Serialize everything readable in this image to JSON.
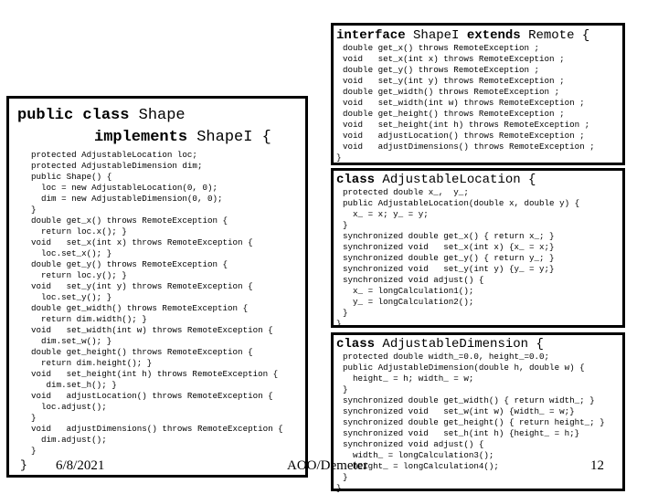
{
  "interface_box": {
    "kw1": "interface",
    "name": "ShapeI",
    "kw2": "extends",
    "parent": "Remote {",
    "lines": [
      "double get_x() throws RemoteException ;",
      "void   set_x(int x) throws RemoteException ;",
      "double get_y() throws RemoteException ;",
      "void   set_y(int y) throws RemoteException ;",
      "double get_width() throws RemoteException ;",
      "void   set_width(int w) throws RemoteException ;",
      "double get_height() throws RemoteException ;",
      "void   set_height(int h) throws RemoteException ;",
      "void   adjustLocation() throws RemoteException ;",
      "void   adjustDimensions() throws RemoteException ;"
    ],
    "close": "}"
  },
  "location_box": {
    "kw": "class",
    "name": "AdjustableLocation {",
    "lines": [
      "protected double x_,  y_;",
      "public AdjustableLocation(double x, double y) {",
      "  x_ = x; y_ = y;",
      "}",
      "synchronized double get_x() { return x_; }",
      "synchronized void   set_x(int x) {x_ = x;}",
      "synchronized double get_y() { return y_; }",
      "synchronized void   set_y(int y) {y_ = y;}",
      "synchronized void adjust() {",
      "  x_ = longCalculation1();",
      "  y_ = longCalculation2();",
      "}"
    ],
    "close": "}"
  },
  "dimension_box": {
    "kw": "class",
    "name": "AdjustableDimension {",
    "lines": [
      "protected double width_=0.0, height_=0.0;",
      "public AdjustableDimension(double h, double w) {",
      "  height_ = h; width_ = w;",
      "}",
      "synchronized double get_width() { return width_; }",
      "synchronized void   set_w(int w) {width_ = w;}",
      "synchronized double get_height() { return height_; }",
      "synchronized void   set_h(int h) {height_ = h;}",
      "synchronized void adjust() {",
      "  width_ = longCalculation3();",
      "  height_ = longCalculation4();",
      "}"
    ],
    "close": "}"
  },
  "shape_box": {
    "kw1": "public class",
    "name": "Shape",
    "kw2": "implements",
    "iface": "ShapeI {",
    "lines": [
      "protected AdjustableLocation loc;",
      "protected AdjustableDimension dim;",
      "public Shape() {",
      "  loc = new AdjustableLocation(0, 0);",
      "  dim = new AdjustableDimension(0, 0);",
      "}",
      "double get_x() throws RemoteException {",
      "  return loc.x(); }",
      "void   set_x(int x) throws RemoteException {",
      "  loc.set_x(); }",
      "double get_y() throws RemoteException {",
      "  return loc.y(); }",
      "void   set_y(int y) throws RemoteException {",
      "  loc.set_y(); }",
      "double get_width() throws RemoteException {",
      "  return dim.width(); }",
      "void   set_width(int w) throws RemoteException {",
      "  dim.set_w(); }",
      "double get_height() throws RemoteException {",
      "  return dim.height(); }",
      "void   set_height(int h) throws RemoteException {",
      "   dim.set_h(); }",
      "void   adjustLocation() throws RemoteException {",
      "  loc.adjust();",
      "}",
      "void   adjustDimensions() throws RemoteException {",
      "  dim.adjust();",
      "}"
    ],
    "close": "}"
  },
  "footer": {
    "date": "6/8/2021",
    "title": "AOO/Demeter",
    "page": "12"
  }
}
